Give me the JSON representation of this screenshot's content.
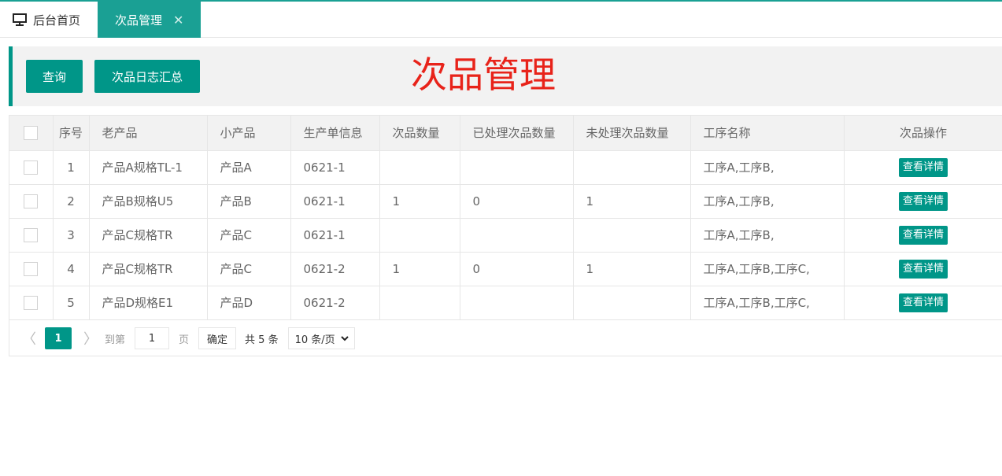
{
  "tabs": {
    "home_label": "后台首页",
    "active_label": "次品管理",
    "close_glyph": "✕"
  },
  "toolbar": {
    "search_label": "查询",
    "log_label": "次品日志汇总",
    "heading": "次品管理",
    "heading_color": "#e8231a"
  },
  "table": {
    "headers": [
      "序号",
      "老产品",
      "小产品",
      "生产单信息",
      "次品数量",
      "已处理次品数量",
      "未处理次品数量",
      "工序名称",
      "次品操作"
    ],
    "rows": [
      {
        "no": "1",
        "old": "产品A规格TL-1",
        "small": "产品A",
        "order": "0621-1",
        "defect": "",
        "handled": "",
        "unhandled": "",
        "process": "工序A,工序B,",
        "action": "查看详情"
      },
      {
        "no": "2",
        "old": "产品B规格U5",
        "small": "产品B",
        "order": "0621-1",
        "defect": "1",
        "handled": "0",
        "unhandled": "1",
        "process": "工序A,工序B,",
        "action": "查看详情"
      },
      {
        "no": "3",
        "old": "产品C规格TR",
        "small": "产品C",
        "order": "0621-1",
        "defect": "",
        "handled": "",
        "unhandled": "",
        "process": "工序A,工序B,",
        "action": "查看详情"
      },
      {
        "no": "4",
        "old": "产品C规格TR",
        "small": "产品C",
        "order": "0621-2",
        "defect": "1",
        "handled": "0",
        "unhandled": "1",
        "process": "工序A,工序B,工序C,",
        "action": "查看详情"
      },
      {
        "no": "5",
        "old": "产品D规格E1",
        "small": "产品D",
        "order": "0621-2",
        "defect": "",
        "handled": "",
        "unhandled": "",
        "process": "工序A,工序B,工序C,",
        "action": "查看详情"
      }
    ]
  },
  "pagination": {
    "prev_glyph": "〈",
    "next_glyph": "〉",
    "current_page": "1",
    "goto_label": "到第",
    "goto_value": "1",
    "page_unit": "页",
    "confirm_label": "确定",
    "total_label": "共 5 条",
    "page_size_label": "10 条/页"
  },
  "colors": {
    "accent": "#009688",
    "tab_active": "#1aa094"
  }
}
